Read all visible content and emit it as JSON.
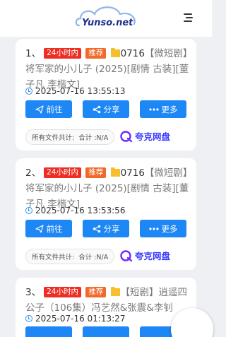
{
  "header": {
    "logo_text": "Yunso.net"
  },
  "tags": {
    "hot": "24小时内",
    "recommend": "推荐"
  },
  "buttons": {
    "go": "前往",
    "share": "分享",
    "more": "更多"
  },
  "meta": {
    "label": "所有文件共计:",
    "total": "合计 :N/A"
  },
  "provider": "夸克网盘",
  "colors": {
    "accent": "#1d87f5",
    "tag_red": "#ee2e24",
    "tag_orange": "#f2682a",
    "quark": "#3b3bff"
  },
  "results": [
    {
      "index": "1、",
      "title_prefix": "0716",
      "title_name": "【微短剧】将军家的小儿子 (2025)[剧情 古装][董子凡 李楷文]",
      "time": "2025-07-16 13:55:13"
    },
    {
      "index": "2、",
      "title_prefix": "0716",
      "title_name": "【微短剧】将军家的小儿子 (2025)[剧情 古装][董子凡 李楷文]",
      "time": "2025-07-16 13:53:56"
    },
    {
      "index": "3、",
      "title_prefix": "",
      "title_name": "【短剧】逍遥四公子（106集）冯艺然&张震&李钊",
      "time": "2025-07-16 01:13:27"
    }
  ]
}
